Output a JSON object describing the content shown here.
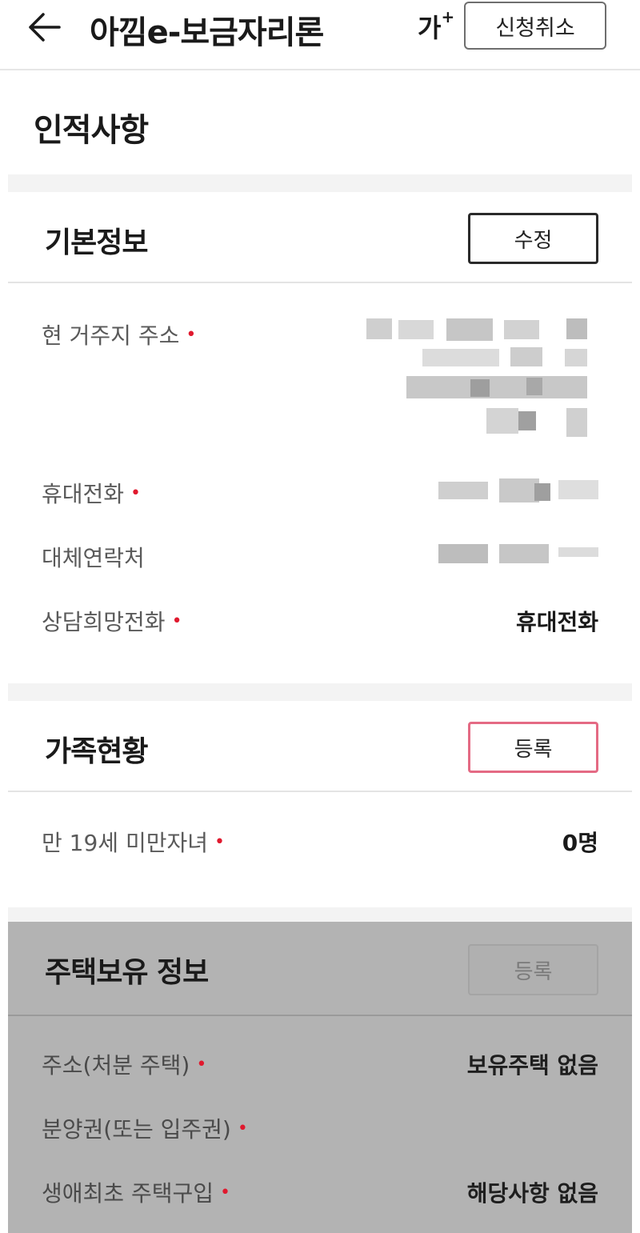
{
  "topbar": {
    "title": "아낌e-보금자리론",
    "font_size_glyph": "가",
    "font_size_plus": "+",
    "cancel_label": "신청취소"
  },
  "page_title": "인적사항",
  "required_mark": "•",
  "basic_info": {
    "title": "기본정보",
    "edit_label": "수정",
    "rows": [
      {
        "label": "현 거주지 주소",
        "required": true,
        "value": ""
      },
      {
        "label": "휴대전화",
        "required": true,
        "value": ""
      },
      {
        "label": "대체연락처",
        "required": false,
        "value": ""
      },
      {
        "label": "상담희망전화",
        "required": true,
        "value": "휴대전화"
      }
    ]
  },
  "family": {
    "title": "가족현황",
    "register_label": "등록",
    "rows": [
      {
        "label": "만 19세 미만자녀",
        "required": true,
        "value": "0명"
      }
    ]
  },
  "housing": {
    "title": "주택보유 정보",
    "register_label": "등록",
    "rows": [
      {
        "label": "주소(처분 주택)",
        "required": true,
        "value": "보유주택 없음"
      },
      {
        "label": "분양권(또는 입주권)",
        "required": true,
        "value": ""
      },
      {
        "label": "생애최초 주택구입",
        "required": true,
        "value": "해당사항 없음"
      }
    ]
  },
  "colors": {
    "required": "#e0192e",
    "register_border": "#e46a84",
    "disabled_overlay": "#b3b3b3"
  }
}
